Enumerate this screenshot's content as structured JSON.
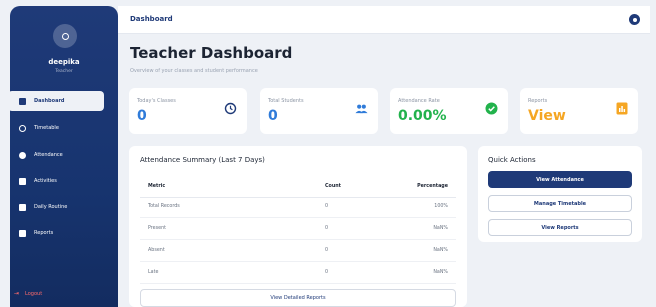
{
  "sidebar": {
    "user_name": "deepika",
    "user_role": "Teacher",
    "items": [
      {
        "label": "Dashboard",
        "icon": "grid-icon"
      },
      {
        "label": "Timetable",
        "icon": "clock-icon"
      },
      {
        "label": "Attendance",
        "icon": "check-circle-icon"
      },
      {
        "label": "Activities",
        "icon": "clipboard-icon"
      },
      {
        "label": "Daily Routine",
        "icon": "calendar-icon"
      },
      {
        "label": "Reports",
        "icon": "chart-icon"
      }
    ],
    "logout_label": "Logout"
  },
  "topbar": {
    "title": "Dashboard"
  },
  "header": {
    "title": "Teacher Dashboard",
    "subtitle": "Overview of your classes and student performance"
  },
  "stats": [
    {
      "label": "Today's Classes",
      "value": "0",
      "icon": "clock-icon",
      "color": "#2f7bd9"
    },
    {
      "label": "Total Students",
      "value": "0",
      "icon": "users-icon",
      "color": "#2f7bd9"
    },
    {
      "label": "Attendance Rate",
      "value": "0.00%",
      "icon": "check-circle-icon",
      "color": "#22b24c"
    },
    {
      "label": "Reports",
      "value": "View",
      "icon": "chart-icon",
      "color": "#f5a623"
    }
  ],
  "attendance": {
    "title": "Attendance Summary (Last 7 Days)",
    "columns": [
      "Metric",
      "Count",
      "Percentage"
    ],
    "rows": [
      {
        "metric": "Total Records",
        "count": "0",
        "percentage": "100%"
      },
      {
        "metric": "Present",
        "count": "0",
        "percentage": "NaN%"
      },
      {
        "metric": "Absent",
        "count": "0",
        "percentage": "NaN%"
      },
      {
        "metric": "Late",
        "count": "0",
        "percentage": "NaN%"
      }
    ],
    "button_label": "View Detailed Reports"
  },
  "quick_actions": {
    "title": "Quick Actions",
    "buttons": [
      "View Attendance",
      "Manage Timetable",
      "View Reports"
    ]
  }
}
